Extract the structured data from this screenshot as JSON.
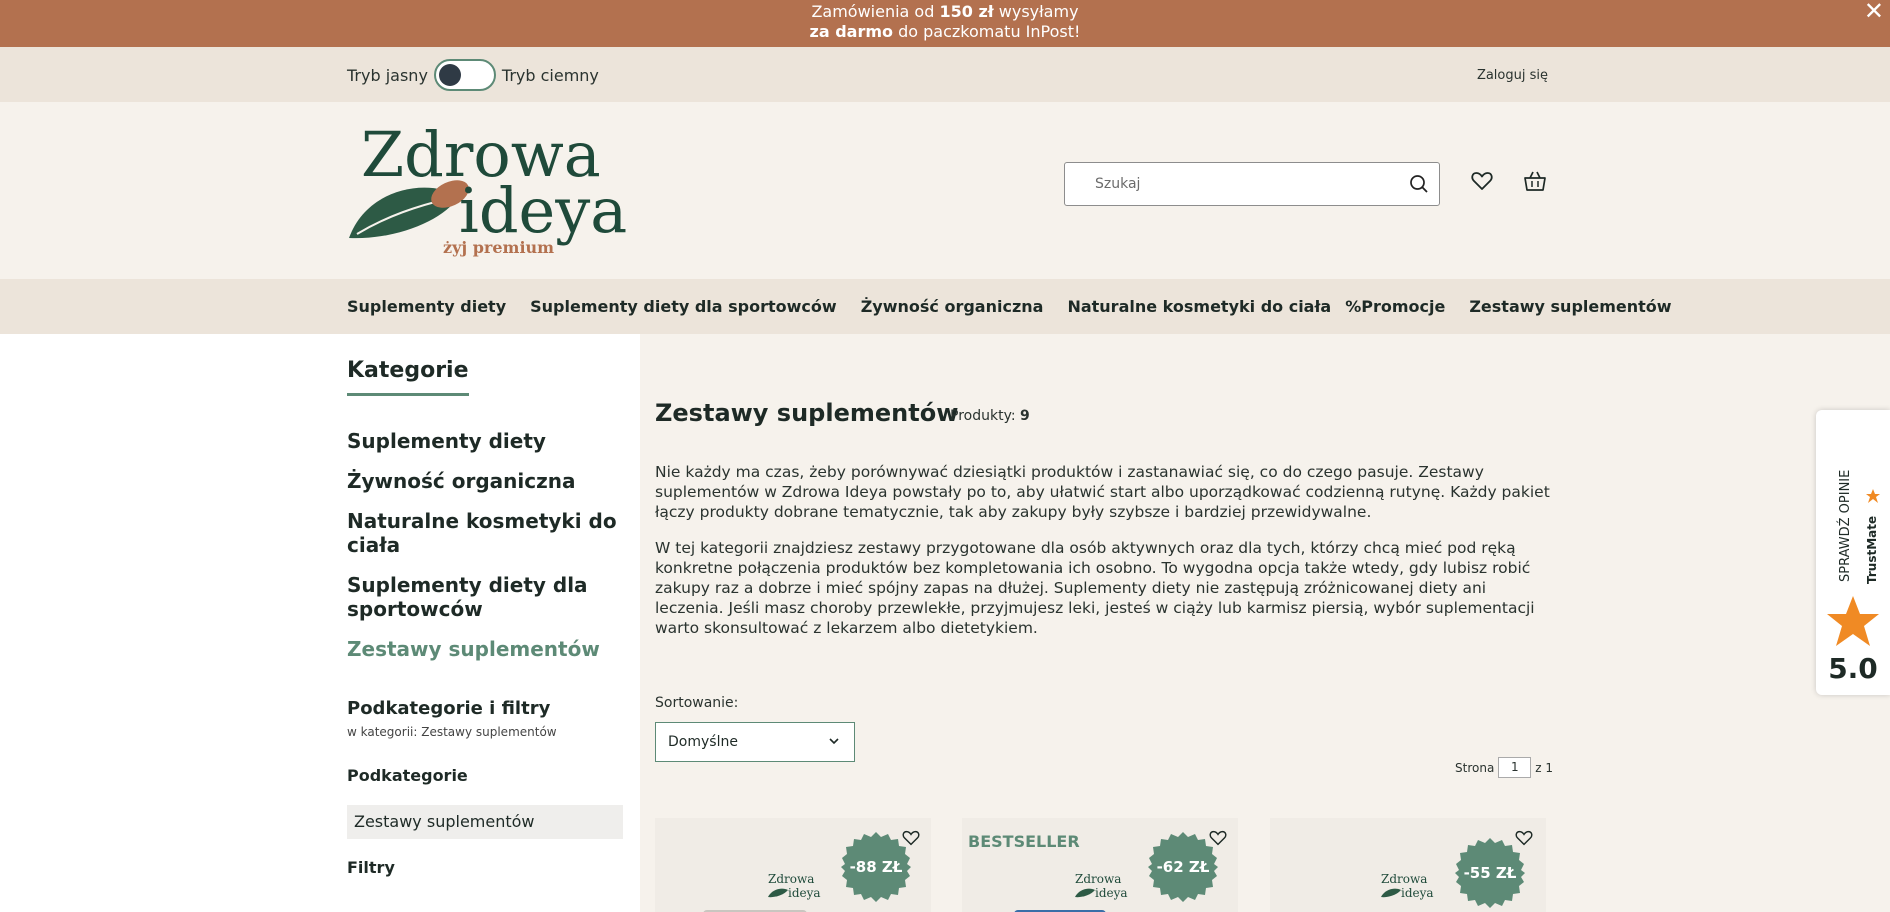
{
  "promo": {
    "line1_a": "Zamówienia od ",
    "line1_b": "150 zł",
    "line1_c": " wysyłamy",
    "line2_a": "za darmo",
    "line2_b": " do paczkomatu InPost!"
  },
  "theme": {
    "light_label": "Tryb jasny",
    "dark_label": "Tryb ciemny"
  },
  "account": {
    "login_label": "Zaloguj się"
  },
  "logo": {
    "line1": "Zdrowa",
    "line2": "ideya",
    "tagline": "żyj premium"
  },
  "search": {
    "placeholder": "Szukaj"
  },
  "nav": {
    "items": [
      "Suplementy diety",
      "Suplementy diety dla sportowców",
      "Żywność organiczna",
      "Naturalne kosmetyki do ciała",
      "%Promocje",
      "Zestawy suplementów"
    ]
  },
  "sidebar": {
    "title": "Kategorie",
    "categories": [
      "Suplementy diety",
      "Żywność organiczna",
      "Naturalne kosmetyki do ciała",
      "Suplementy diety dla sportowców",
      "Zestawy suplementów"
    ],
    "subfilters_heading": "Podkategorie i filtry",
    "subfilters_note": "w kategorii: Zestawy suplementów",
    "subcategories_heading": "Podkategorie",
    "subcategory_item": "Zestawy suplementów",
    "filters_heading": "Filtry"
  },
  "main": {
    "title": "Zestawy suplementów",
    "count_label": "Produkty:",
    "count_value": "9",
    "desc1": "Nie każdy ma czas, żeby porównywać dziesiątki produktów i zastanawiać się, co do czego pasuje. Zestawy suplementów w Zdrowa Ideya powstały po to, aby ułatwić start albo uporządkować codzienną rutynę. Każdy pakiet łączy produkty dobrane tematycznie, tak aby zakupy były szybsze i bardziej przewidywalne.",
    "desc2": "W tej kategorii znajdziesz zestawy przygotowane dla osób aktywnych oraz dla tych, którzy chcą mieć pod ręką konkretne połączenia produktów bez kompletowania ich osobno. To wygodna opcja także wtedy, gdy lubisz robić zakupy raz a dobrze i mieć spójny zapas na dłużej. Suplementy diety nie zastępują zróżnicowanej diety ani leczenia. Jeśli masz choroby przewlekłe, przyjmujesz leki, jesteś w ciąży lub karmisz piersią, wybór suplementacji warto skonsultować z lekarzem albo dietetykiem.",
    "sort_label": "Sortowanie:",
    "sort_value": "Domyślne",
    "page_label": "Strona",
    "page_value": "1",
    "page_of": "z 1"
  },
  "products": [
    {
      "badge": "-88 ZŁ",
      "label": ""
    },
    {
      "badge": "-62 ZŁ",
      "label": "BESTSELLER"
    },
    {
      "badge": "-55 ZŁ",
      "label": ""
    }
  ],
  "mini_logo": {
    "line1": "Zdrowa",
    "line2": "ideya"
  },
  "trustmate": {
    "cta": "SPRAWDŹ OPINIE",
    "brand": "TrustMate",
    "score": "5.0"
  },
  "colors": {
    "promo_bg": "#b3714f",
    "accent_green": "#5d8a76",
    "cream": "#f6f2ec",
    "band": "#ece4da"
  }
}
